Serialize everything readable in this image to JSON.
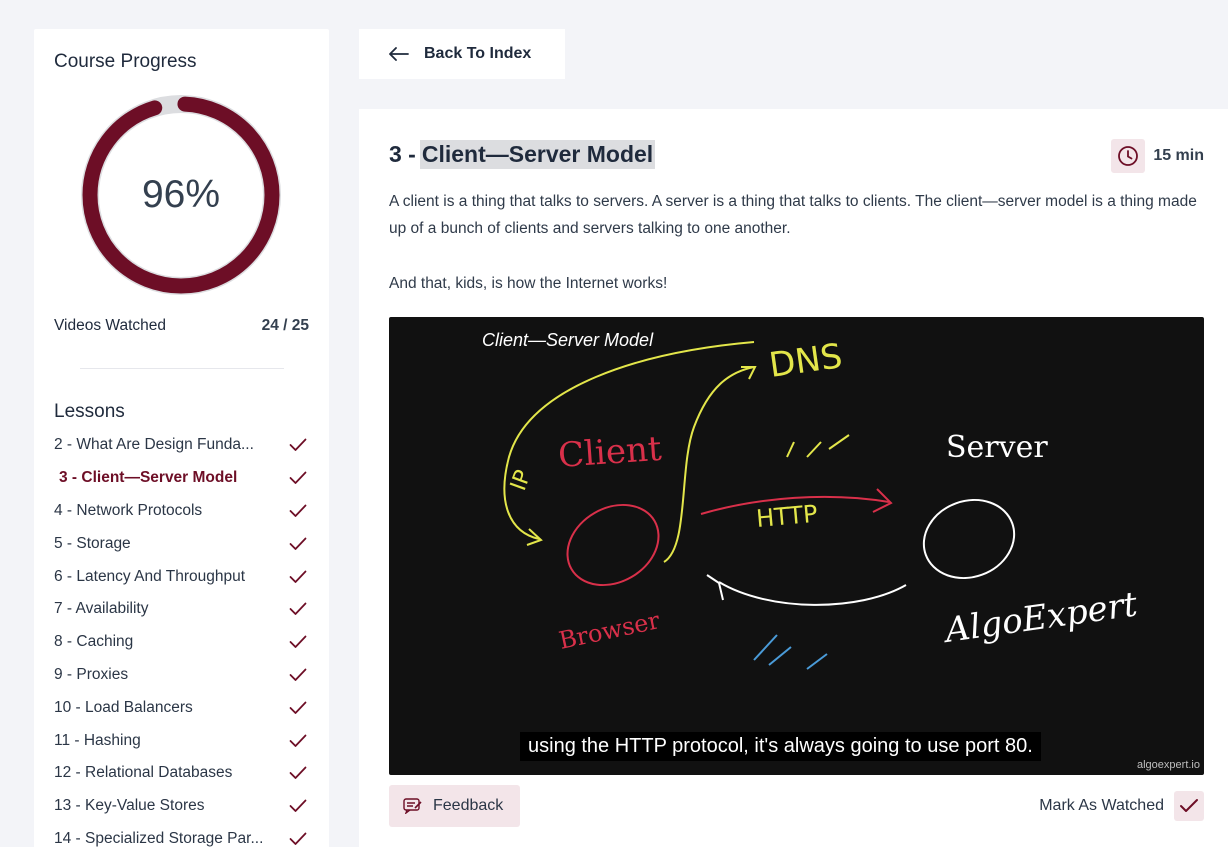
{
  "sidebar": {
    "title": "Course Progress",
    "progress_percent": 96,
    "progress_label": "96%",
    "videos_watched_label": "Videos Watched",
    "videos_watched_count": "24 / 25",
    "lessons_title": "Lessons",
    "lessons": [
      {
        "label": "2 - What Are Design Funda...",
        "watched": true,
        "active": false
      },
      {
        "label": "3 - Client—Server Model",
        "watched": true,
        "active": true
      },
      {
        "label": "4 - Network Protocols",
        "watched": true,
        "active": false
      },
      {
        "label": "5 - Storage",
        "watched": true,
        "active": false
      },
      {
        "label": "6 - Latency And Throughput",
        "watched": true,
        "active": false
      },
      {
        "label": "7 - Availability",
        "watched": true,
        "active": false
      },
      {
        "label": "8 - Caching",
        "watched": true,
        "active": false
      },
      {
        "label": "9 - Proxies",
        "watched": true,
        "active": false
      },
      {
        "label": "10 - Load Balancers",
        "watched": true,
        "active": false
      },
      {
        "label": "11 - Hashing",
        "watched": true,
        "active": false
      },
      {
        "label": "12 - Relational Databases",
        "watched": true,
        "active": false
      },
      {
        "label": "13 - Key-Value Stores",
        "watched": true,
        "active": false
      },
      {
        "label": "14 - Specialized Storage Par...",
        "watched": true,
        "active": false
      }
    ]
  },
  "back_button": {
    "label": "Back To Index",
    "icon": "arrow-left-icon"
  },
  "lesson": {
    "number_prefix": "3 -",
    "title": "Client—Server Model",
    "duration": "15 min",
    "description_1": "A client is a thing that talks to servers. A server is a thing that talks to clients. The client—server model is a thing made up of a bunch of clients and servers talking to one another.",
    "description_2": "And that, kids, is how the Internet works!"
  },
  "video": {
    "board_title": "Client—Server Model",
    "board_labels": {
      "dns": "DNS",
      "ip": "IP",
      "client": "Client",
      "server": "Server",
      "http": "HTTP",
      "browser": "Browser",
      "algoexpert": "AlgoExpert"
    },
    "caption": "using the HTTP protocol, it's always going to use port 80.",
    "watermark": "algoexpert.io"
  },
  "footer": {
    "feedback_label": "Feedback",
    "mark_watched_label": "Mark As Watched",
    "mark_watched_checked": true
  },
  "colors": {
    "accent": "#6d0e26",
    "accent_light": "#f3e5e9",
    "background": "#f3f4f8",
    "ring_track": "#dcdde0"
  }
}
